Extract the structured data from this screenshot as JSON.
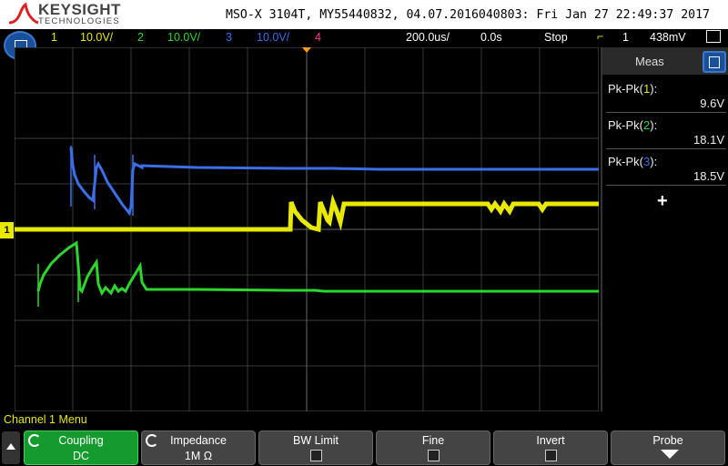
{
  "brand": {
    "name": "KEYSIGHT",
    "sub": "TECHNOLOGIES"
  },
  "device_info": "MSO-X 3104T, MY55440832, 04.07.2016040803: Fri Jan 27 22:49:37 2017",
  "status": {
    "ch1": {
      "num": "1",
      "scale": "10.0V/",
      "color": "#e8e800"
    },
    "ch2": {
      "num": "2",
      "scale": "10.0V/",
      "color": "#2dd62d"
    },
    "ch3": {
      "num": "3",
      "scale": "10.0V/",
      "color": "#3a6fe8"
    },
    "ch4": {
      "num": "4",
      "color": "#ff3b8e"
    },
    "timebase": "200.0us/",
    "delay": "0.0s",
    "run_state": "Stop",
    "trigger_channel": "1",
    "trigger_level": "438mV"
  },
  "meas": {
    "title": "Meas",
    "items": [
      {
        "label_prefix": "Pk-Pk(",
        "channel": "1",
        "label_suffix": "):",
        "value": "9.6V",
        "color": "#e8e800"
      },
      {
        "label_prefix": "Pk-Pk(",
        "channel": "2",
        "label_suffix": "):",
        "value": "18.1V",
        "color": "#2dd62d"
      },
      {
        "label_prefix": "Pk-Pk(",
        "channel": "3",
        "label_suffix": "):",
        "value": "18.5V",
        "color": "#3a6fe8"
      }
    ],
    "add_label": "+"
  },
  "channel_menu_title": "Channel 1 Menu",
  "softkeys": {
    "coupling": {
      "title": "Coupling",
      "value": "DC"
    },
    "impedance": {
      "title": "Impedance",
      "value": "1M Ω"
    },
    "bw_limit": {
      "title": "BW Limit"
    },
    "fine": {
      "title": "Fine"
    },
    "invert": {
      "title": "Invert"
    },
    "probe": {
      "title": "Probe"
    }
  },
  "icons": [
    "menu-icon",
    "trigger-icon",
    "up-arrow-icon",
    "knob-icon",
    "down-arrow-icon",
    "ground-marker-icon"
  ]
}
